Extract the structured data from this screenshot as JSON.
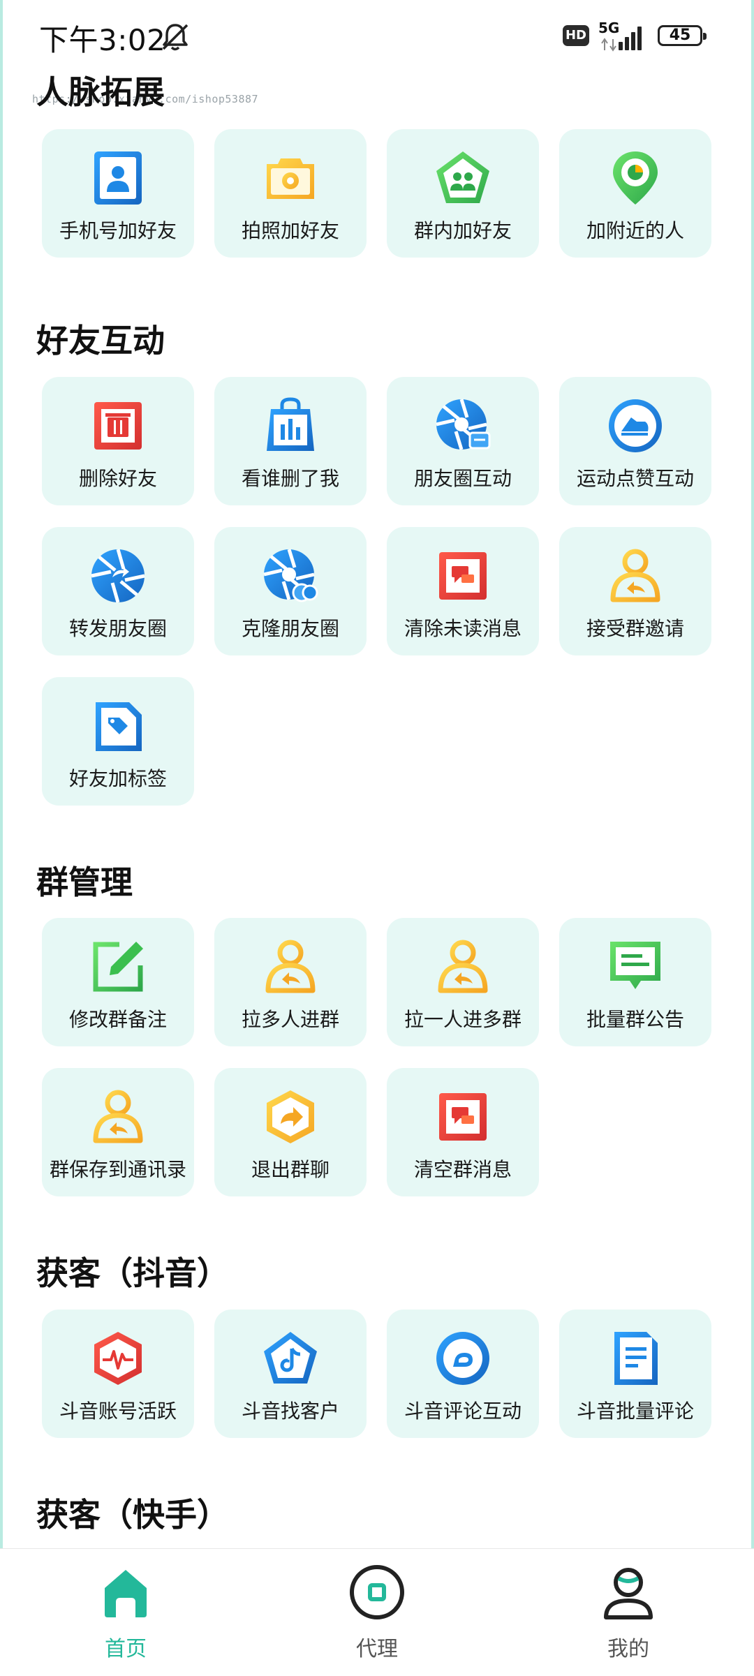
{
  "status_bar": {
    "time": "下午3:02",
    "hd": "HD",
    "network": "5G",
    "battery": "45"
  },
  "watermark": "https://shop.xianyu.com/ishop53887",
  "sections": [
    {
      "title": "人脉拓展",
      "items": [
        {
          "label": "手机号加好友",
          "icon": "contact-card-icon"
        },
        {
          "label": "拍照加好友",
          "icon": "camera-icon"
        },
        {
          "label": "群内加好友",
          "icon": "group-pentagon-icon"
        },
        {
          "label": "加附近的人",
          "icon": "location-pin-icon"
        }
      ]
    },
    {
      "title": "好友互动",
      "items": [
        {
          "label": "删除好友",
          "icon": "trash-icon"
        },
        {
          "label": "看谁删了我",
          "icon": "shopping-bag-chart-icon"
        },
        {
          "label": "朋友圈互动",
          "icon": "aperture-interact-icon"
        },
        {
          "label": "运动点赞互动",
          "icon": "sport-shoe-icon"
        },
        {
          "label": "转发朋友圈",
          "icon": "aperture-forward-icon"
        },
        {
          "label": "克隆朋友圈",
          "icon": "aperture-clone-icon"
        },
        {
          "label": "清除未读消息",
          "icon": "message-square-icon"
        },
        {
          "label": "接受群邀请",
          "icon": "person-reply-icon"
        },
        {
          "label": "好友加标签",
          "icon": "tag-icon"
        }
      ]
    },
    {
      "title": "群管理",
      "items": [
        {
          "label": "修改群备注",
          "icon": "edit-icon"
        },
        {
          "label": "拉多人进群",
          "icon": "person-reply-icon"
        },
        {
          "label": "拉一人进多群",
          "icon": "person-reply-icon"
        },
        {
          "label": "批量群公告",
          "icon": "announcement-icon"
        },
        {
          "label": "群保存到通讯录",
          "icon": "person-reply-icon"
        },
        {
          "label": "退出群聊",
          "icon": "hexagon-forward-icon"
        },
        {
          "label": "清空群消息",
          "icon": "message-square-icon"
        }
      ]
    },
    {
      "title": "获客（抖音）",
      "items": [
        {
          "label": "斗音账号活跃",
          "icon": "hexagon-pulse-icon"
        },
        {
          "label": "斗音找客户",
          "icon": "pentagon-music-icon"
        },
        {
          "label": "斗音评论互动",
          "icon": "circle-comment-icon"
        },
        {
          "label": "斗音批量评论",
          "icon": "document-icon"
        }
      ]
    },
    {
      "title": "获客（快手）",
      "items": []
    }
  ],
  "bottom_nav": [
    {
      "label": "首页",
      "icon": "home-icon",
      "active": true
    },
    {
      "label": "代理",
      "icon": "agent-icon",
      "active": false
    },
    {
      "label": "我的",
      "icon": "profile-icon",
      "active": false
    }
  ],
  "colors": {
    "accent": "#23b89a",
    "tile_bg": "#e6f8f5",
    "blue": "#1e88e5",
    "yellow": "#f7c325",
    "red": "#e53935",
    "green": "#4ccf4c"
  }
}
